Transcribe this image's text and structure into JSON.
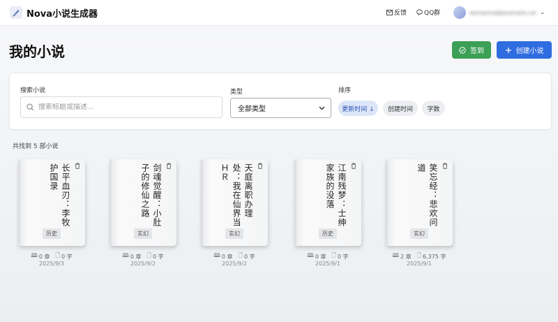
{
  "app": {
    "title": "Nova小说生成器"
  },
  "nav": {
    "feedback": "反馈",
    "qq_group": "QQ群",
    "user_name": "wangxing@example.com"
  },
  "page": {
    "title": "我的小说",
    "checkin_label": "签到",
    "create_label": "创建小说"
  },
  "filters": {
    "search_label": "搜索小说",
    "search_placeholder": "搜索标题或描述...",
    "type_label": "类型",
    "type_selected": "全部类型",
    "sort_label": "排序",
    "sort_options": [
      {
        "label": "更新时间 ↓",
        "active": true
      },
      {
        "label": "创建时间",
        "active": false
      },
      {
        "label": "字数",
        "active": false
      }
    ]
  },
  "result_count": "共找到 5 部小说",
  "books": [
    {
      "title": "长平血刃：李牧护国录",
      "genre": "历史",
      "chapters": "0 章",
      "words": "0 字",
      "date": "2025/9/3"
    },
    {
      "title": "剑魂觉醒：小肚子的修仙之路",
      "genre": "玄幻",
      "chapters": "0 章",
      "words": "0 字",
      "date": "2025/9/2"
    },
    {
      "title": "天庭离职办理处：我在仙界当ＨＲ",
      "genre": "玄幻",
      "chapters": "0 章",
      "words": "0 字",
      "date": "2025/9/2"
    },
    {
      "title": "江南残梦：士绅家族的没落",
      "genre": "历史",
      "chapters": "0 章",
      "words": "0 字",
      "date": "2025/9/1"
    },
    {
      "title": "笑忘经：悲欢问道",
      "genre": "玄幻",
      "chapters": "2 章",
      "words": "6,375 字",
      "date": "2025/9/1"
    }
  ],
  "colors": {
    "checkin": "#3c9f56",
    "create": "#2f6ce0",
    "active_sort": "#dde6f8"
  }
}
